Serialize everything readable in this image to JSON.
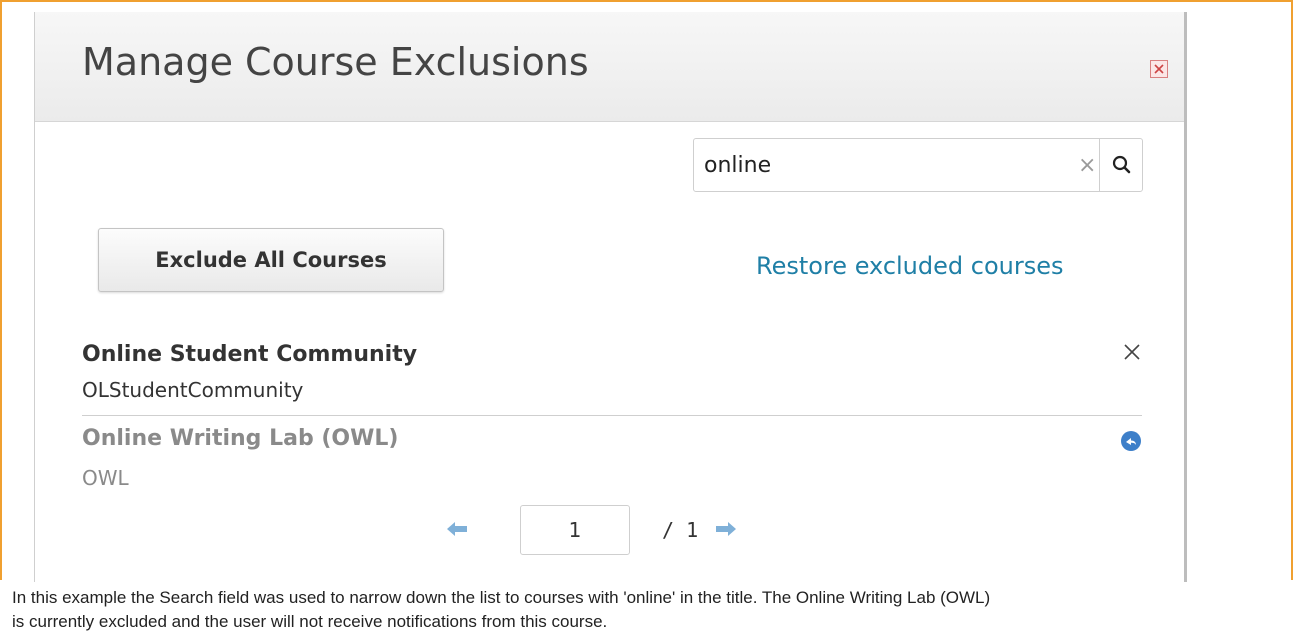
{
  "dialog": {
    "title": "Manage Course Exclusions"
  },
  "search": {
    "value": "online"
  },
  "actions": {
    "exclude_all_label": "Exclude All Courses",
    "restore_link_label": "Restore excluded courses"
  },
  "courses": [
    {
      "title": "Online Student Community",
      "code": "OLStudentCommunity",
      "excluded": false,
      "action_icon": "close-x-icon"
    },
    {
      "title": "Online Writing Lab (OWL)",
      "code": "OWL",
      "excluded": true,
      "action_icon": "restore-icon"
    }
  ],
  "pagination": {
    "current_page": "1",
    "total_pages": "/ 1"
  },
  "caption": {
    "line1": "In this example the Search field was used to narrow down the list to courses with 'online' in the title. The Online Writing Lab (OWL)",
    "line2": "is currently excluded and the user will not receive notifications from this course."
  },
  "colors": {
    "frame_border": "#f0a030",
    "link": "#1f7fa6",
    "arrow": "#7fb0d8",
    "close_icon": "#d98080"
  }
}
